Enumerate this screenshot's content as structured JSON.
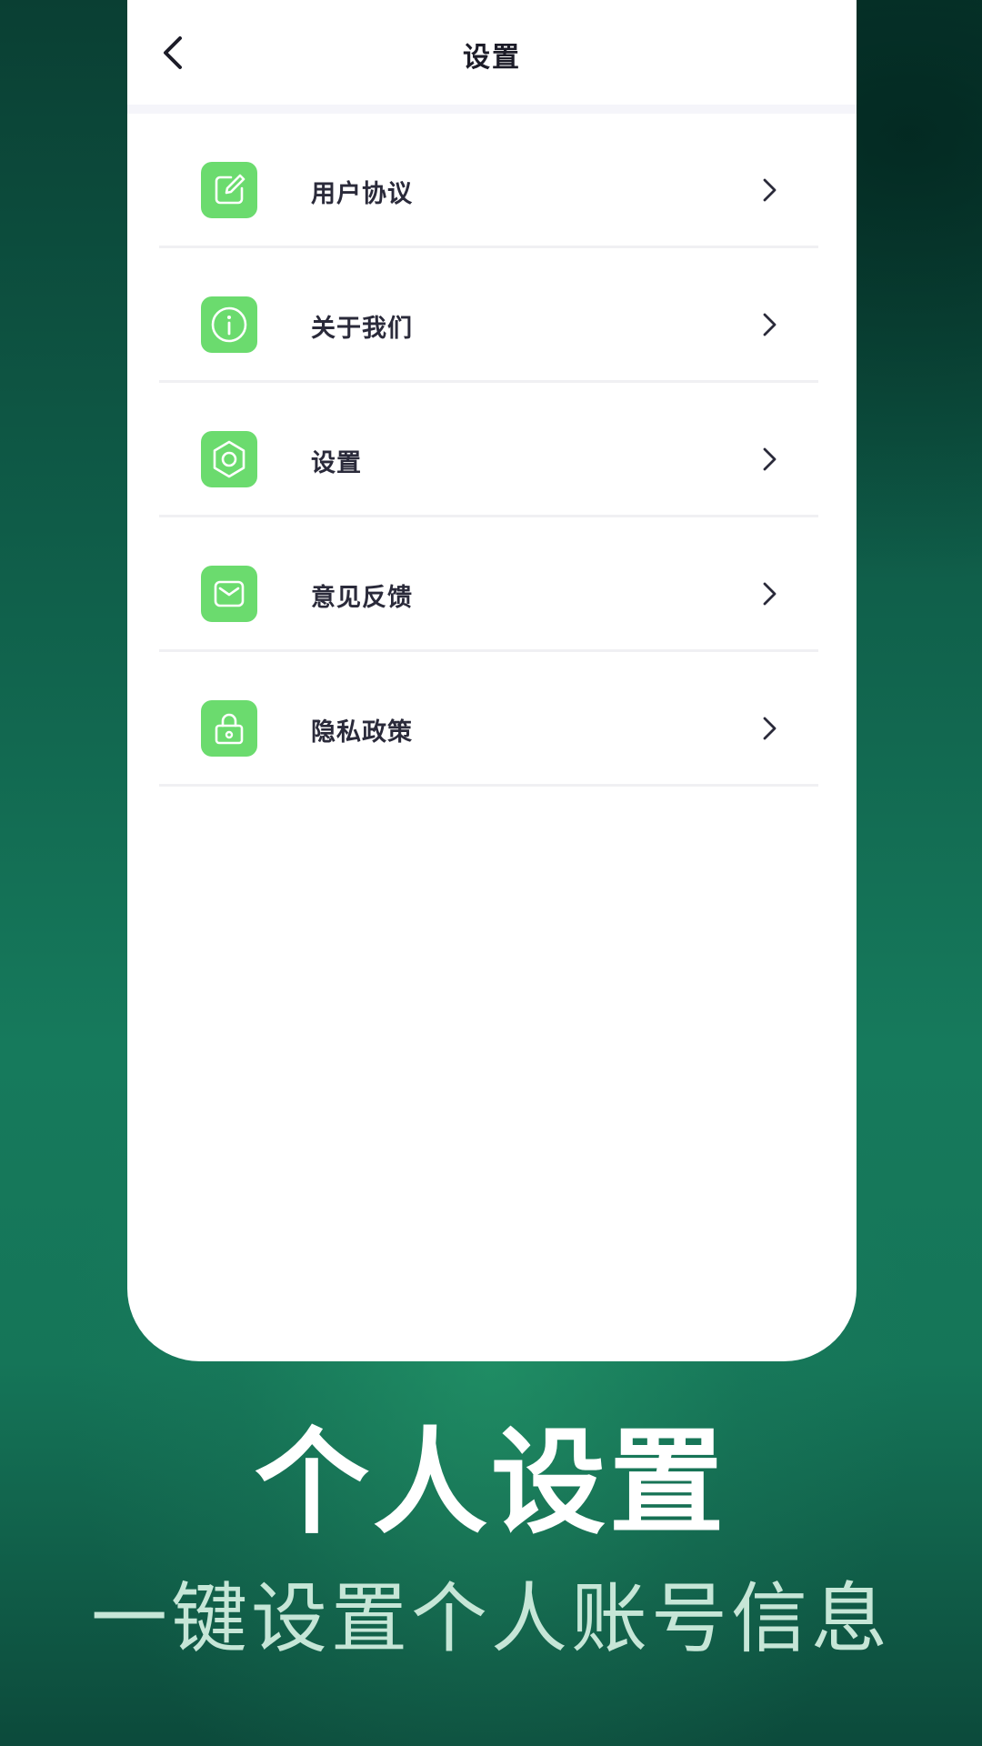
{
  "header": {
    "title": "设置",
    "back_icon": "chevron-left-icon"
  },
  "menu": {
    "items": [
      {
        "label": "用户协议",
        "icon": "edit-icon"
      },
      {
        "label": "关于我们",
        "icon": "info-icon"
      },
      {
        "label": "设置",
        "icon": "gear-icon"
      },
      {
        "label": "意见反馈",
        "icon": "mail-icon"
      },
      {
        "label": "隐私政策",
        "icon": "lock-icon"
      }
    ]
  },
  "promo": {
    "headline": "个人设置",
    "subline": "一键设置个人账号信息"
  },
  "colors": {
    "accent": "#6bdb6e",
    "background_dark": "#0a3f33",
    "background_mid": "#167a5c"
  }
}
